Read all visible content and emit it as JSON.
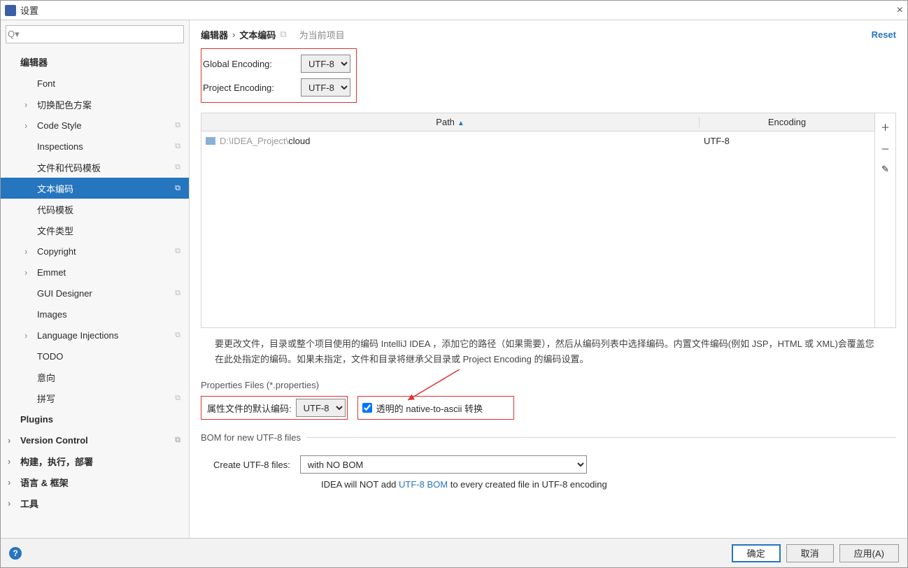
{
  "window": {
    "title": "设置"
  },
  "search": {
    "placeholder": ""
  },
  "sidebar": {
    "header": "编辑器",
    "items": [
      {
        "label": "Font",
        "chev": false,
        "l": 1,
        "cp": false
      },
      {
        "label": "切换配色方案",
        "chev": true,
        "l": 1,
        "cp": false
      },
      {
        "label": "Code Style",
        "chev": true,
        "l": 1,
        "cp": true
      },
      {
        "label": "Inspections",
        "chev": false,
        "l": 1,
        "cp": true
      },
      {
        "label": "文件和代码模板",
        "chev": false,
        "l": 1,
        "cp": true
      },
      {
        "label": "文本编码",
        "chev": false,
        "l": 1,
        "cp": true,
        "selected": true
      },
      {
        "label": "代码模板",
        "chev": false,
        "l": 1,
        "cp": false
      },
      {
        "label": "文件类型",
        "chev": false,
        "l": 1,
        "cp": false
      },
      {
        "label": "Copyright",
        "chev": true,
        "l": 1,
        "cp": true
      },
      {
        "label": "Emmet",
        "chev": true,
        "l": 1,
        "cp": false
      },
      {
        "label": "GUI Designer",
        "chev": false,
        "l": 1,
        "cp": true
      },
      {
        "label": "Images",
        "chev": false,
        "l": 1,
        "cp": false
      },
      {
        "label": "Language Injections",
        "chev": true,
        "l": 1,
        "cp": true
      },
      {
        "label": "TODO",
        "chev": false,
        "l": 1,
        "cp": false
      },
      {
        "label": "意向",
        "chev": false,
        "l": 1,
        "cp": false
      },
      {
        "label": "拼写",
        "chev": false,
        "l": 1,
        "cp": true
      }
    ],
    "root_items": [
      {
        "label": "Plugins",
        "chev": false,
        "bold": true
      },
      {
        "label": "Version Control",
        "chev": true,
        "bold": true,
        "cp": true
      },
      {
        "label": "构建，执行，部署",
        "chev": true,
        "bold": true
      },
      {
        "label": "语言 & 框架",
        "chev": true,
        "bold": true
      },
      {
        "label": "工具",
        "chev": true,
        "bold": true
      }
    ]
  },
  "breadcrumb": {
    "a": "编辑器",
    "b": "文本编码",
    "proj": "为当前项目",
    "reset": "Reset"
  },
  "encoding": {
    "global_label": "Global Encoding:",
    "global_value": "UTF-8",
    "project_label": "Project Encoding:",
    "project_value": "UTF-8"
  },
  "table": {
    "col1": "Path",
    "col2": "Encoding",
    "rows": [
      {
        "path_pre": "D:\\IDEA_Project\\",
        "path_main": "cloud",
        "enc": "UTF-8"
      }
    ]
  },
  "desc": "要更改文件，目录或整个项目使用的编码 IntelliJ IDEA ，添加它的路径（如果需要），然后从编码列表中选择编码。内置文件编码(例如 JSP，HTML 或 XML)会覆盖您在此处指定的编码。如果未指定，文件和目录将继承父目录或 Project Encoding 的编码设置。",
  "props": {
    "section": "Properties Files (*.properties)",
    "label": "属性文件的默认编码:",
    "value": "UTF-8",
    "checkbox": "透明的 native-to-ascii 转换"
  },
  "bom": {
    "legend": "BOM for new UTF-8 files",
    "label": "Create UTF-8 files:",
    "value": "with NO BOM",
    "note_a": "IDEA will NOT add ",
    "note_link": "UTF-8 BOM",
    "note_b": " to every created file in UTF-8 encoding"
  },
  "footer": {
    "ok": "确定",
    "cancel": "取消",
    "apply": "应用(A)"
  }
}
